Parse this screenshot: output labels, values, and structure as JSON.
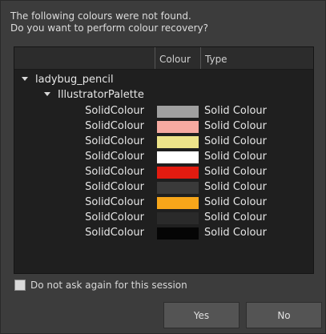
{
  "message": {
    "line1": "The following colours were not found.",
    "line2": "Do you want to perform colour recovery?"
  },
  "table": {
    "headers": {
      "name": "",
      "colour": "Colour",
      "type": "Type"
    },
    "root": "ladybug_pencil",
    "palette": "IllustratorPalette",
    "rows": [
      {
        "name": "SolidColour",
        "color": "#a0a0a0",
        "type": "Solid Colour"
      },
      {
        "name": "SolidColour",
        "color": "#f6aaa1",
        "type": "Solid Colour"
      },
      {
        "name": "SolidColour",
        "color": "#ede48a",
        "type": "Solid Colour"
      },
      {
        "name": "SolidColour",
        "color": "#ffffff",
        "type": "Solid Colour"
      },
      {
        "name": "SolidColour",
        "color": "#e21b10",
        "type": "Solid Colour"
      },
      {
        "name": "SolidColour",
        "color": "#3a3a3a",
        "type": "Solid Colour"
      },
      {
        "name": "SolidColour",
        "color": "#f7a61a",
        "type": "Solid Colour"
      },
      {
        "name": "SolidColour",
        "color": "#2a2a2a",
        "type": "Solid Colour"
      },
      {
        "name": "SolidColour",
        "color": "#050505",
        "type": "Solid Colour"
      }
    ]
  },
  "checkbox": {
    "label": "Do not ask again for this session",
    "checked": false
  },
  "buttons": {
    "yes": "Yes",
    "no": "No"
  }
}
